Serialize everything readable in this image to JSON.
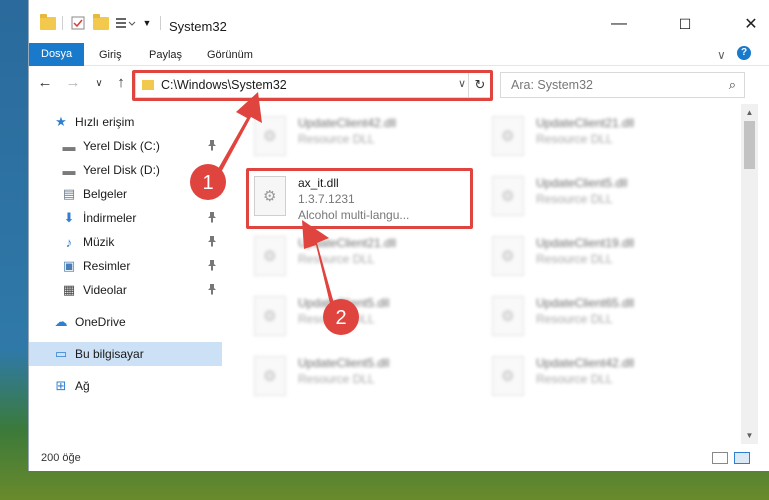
{
  "titlebar": {
    "title": "System32",
    "minimize_glyph": "—",
    "maximize_glyph": "☐",
    "close_glyph": "✕"
  },
  "ribbon": {
    "tabs": [
      "Dosya",
      "Giriş",
      "Paylaş",
      "Görünüm"
    ],
    "collapse_glyph": "∨",
    "help_glyph": "?"
  },
  "address": {
    "path": "C:\\Windows\\System32",
    "dropdown_glyph": "∨",
    "refresh_glyph": "↻"
  },
  "search": {
    "placeholder": "Ara: System32",
    "icon_glyph": "⌕"
  },
  "nav": {
    "back_glyph": "←",
    "forward_glyph": "→",
    "recent_glyph": "∨",
    "up_glyph": "↑"
  },
  "sidebar": {
    "items": [
      {
        "label": "Hızlı erişim",
        "icon": "star-icon",
        "glyph": "★",
        "color": "#2f7fd1",
        "pinned": false
      },
      {
        "label": "Yerel Disk (C:)",
        "icon": "drive-icon",
        "glyph": "▬",
        "color": "#7a7a7a",
        "pinned": true
      },
      {
        "label": "Yerel Disk (D:)",
        "icon": "drive-icon",
        "glyph": "▬",
        "color": "#7a7a7a",
        "pinned": false
      },
      {
        "label": "Belgeler",
        "icon": "documents-icon",
        "glyph": "▤",
        "color": "#6b7b8c",
        "pinned": true
      },
      {
        "label": "İndirmeler",
        "icon": "download-icon",
        "glyph": "⬇",
        "color": "#2f7fd1",
        "pinned": true
      },
      {
        "label": "Müzik",
        "icon": "music-icon",
        "glyph": "♪",
        "color": "#2f7fd1",
        "pinned": true
      },
      {
        "label": "Resimler",
        "icon": "pictures-icon",
        "glyph": "▣",
        "color": "#4a7fb5",
        "pinned": true
      },
      {
        "label": "Videolar",
        "icon": "video-icon",
        "glyph": "▦",
        "color": "#444444",
        "pinned": true
      },
      {
        "label": "OneDrive",
        "icon": "cloud-icon",
        "glyph": "☁",
        "color": "#2f7fd1",
        "pinned": false
      },
      {
        "label": "Bu bilgisayar",
        "icon": "computer-icon",
        "glyph": "▭",
        "color": "#2f7fd1",
        "pinned": false
      },
      {
        "label": "Ağ",
        "icon": "network-icon",
        "glyph": "⊞",
        "color": "#2f7fd1",
        "pinned": false
      }
    ],
    "pin_glyph": "📌"
  },
  "files": [
    {
      "name": "UpdateClient42.dll",
      "line2": "Resource DLL",
      "line3": ""
    },
    {
      "name": "UpdateClient21.dll",
      "line2": "Resource DLL",
      "line3": ""
    },
    {
      "name": "ax_it.dll",
      "line2": "1.3.7.1231",
      "line3": "Alcohol multi-langu..."
    },
    {
      "name": "UpdateClient5.dll",
      "line2": "Resource DLL",
      "line3": ""
    },
    {
      "name": "UpdateClient21.dll",
      "line2": "Resource DLL",
      "line3": ""
    },
    {
      "name": "UpdateClient19.dll",
      "line2": "Resource DLL",
      "line3": ""
    },
    {
      "name": "UpdateClient5.dll",
      "line2": "Resource DLL",
      "line3": ""
    },
    {
      "name": "UpdateClient65.dll",
      "line2": "Resource DLL",
      "line3": ""
    },
    {
      "name": "UpdateClient5.dll",
      "line2": "Resource DLL",
      "line3": ""
    },
    {
      "name": "UpdateClient42.dll",
      "line2": "Resource DLL",
      "line3": ""
    }
  ],
  "annotations": {
    "step1": "1",
    "step2": "2",
    "color": "#e0443e"
  },
  "status": {
    "count": "200 öğe"
  }
}
